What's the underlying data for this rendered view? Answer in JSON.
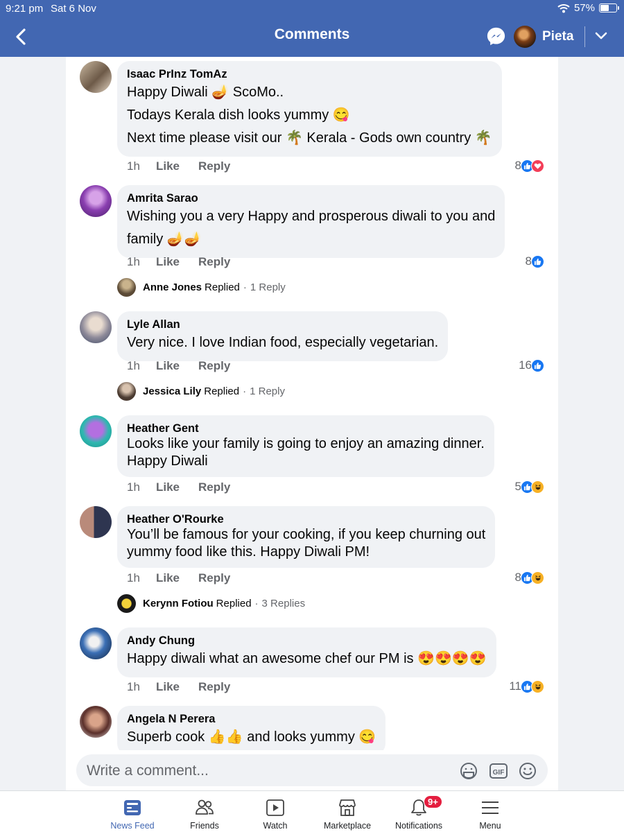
{
  "status": {
    "time": "9:21 pm",
    "date": "Sat 6 Nov",
    "battery": "57%",
    "battery_level": 0.57
  },
  "header": {
    "title": "Comments",
    "user_name": "Pieta"
  },
  "comments": [
    {
      "author": "Isaac PrInz TomAz",
      "lines": [
        "Happy Diwali 🪔 ScoMo..",
        "Todays Kerala dish looks yummy 😋",
        "Next time please visit our 🌴 Kerala - Gods own country 🌴"
      ],
      "age": "1h",
      "like": "Like",
      "reply": "Reply",
      "reaction_count": "8",
      "reactions": [
        "like",
        "love"
      ]
    },
    {
      "author": "Amrita Sarao",
      "lines": [
        "Wishing you a very Happy and prosperous diwali to you and",
        "family 🪔🪔"
      ],
      "age": "1h",
      "like": "Like",
      "reply": "Reply",
      "reaction_count": "8",
      "reactions": [
        "like"
      ],
      "replied": {
        "name": "Anne Jones",
        "verb": "Replied",
        "count": "1 Reply"
      }
    },
    {
      "author": "Lyle Allan",
      "lines": [
        "Very nice. I love Indian food, especially vegetarian."
      ],
      "age": "1h",
      "like": "Like",
      "reply": "Reply",
      "reaction_count": "16",
      "reactions": [
        "like"
      ],
      "replied": {
        "name": "Jessica Lily",
        "verb": "Replied",
        "count": "1 Reply"
      }
    },
    {
      "author": "Heather Gent",
      "lines": [
        "Looks like your family is going to enjoy an amazing dinner.",
        "Happy Diwali"
      ],
      "age": "1h",
      "like": "Like",
      "reply": "Reply",
      "reaction_count": "5",
      "reactions": [
        "like",
        "haha"
      ]
    },
    {
      "author": "Heather O'Rourke",
      "lines": [
        "You’ll be famous for your cooking, if you keep churning out",
        "yummy food like this. Happy Diwali PM!"
      ],
      "age": "1h",
      "like": "Like",
      "reply": "Reply",
      "reaction_count": "8",
      "reactions": [
        "like",
        "haha"
      ],
      "replied": {
        "name": "Kerynn Fotiou",
        "verb": "Replied",
        "count": "3 Replies"
      }
    },
    {
      "author": "Andy Chung",
      "lines": [
        "Happy diwali what an awesome chef our PM is 😍😍😍😍"
      ],
      "age": "1h",
      "like": "Like",
      "reply": "Reply",
      "reaction_count": "11",
      "reactions": [
        "like",
        "haha"
      ]
    },
    {
      "author": "Angela N Perera",
      "lines": [
        "Superb cook 👍👍 and looks yummy 😋"
      ]
    }
  ],
  "replied_sep": "·",
  "composer": {
    "placeholder": "Write a comment..."
  },
  "tabs": [
    {
      "label": "News Feed",
      "icon": "news-feed-icon",
      "active": true
    },
    {
      "label": "Friends",
      "icon": "friends-icon"
    },
    {
      "label": "Watch",
      "icon": "watch-icon"
    },
    {
      "label": "Marketplace",
      "icon": "marketplace-icon"
    },
    {
      "label": "Notifications",
      "icon": "bell-icon",
      "badge": "9+"
    },
    {
      "label": "Menu",
      "icon": "menu-icon"
    }
  ],
  "colors": {
    "brand": "#4267b2",
    "like": "#1877f2",
    "love": "#f33e58",
    "haha": "#f7b125",
    "badge": "#e41e3f"
  }
}
